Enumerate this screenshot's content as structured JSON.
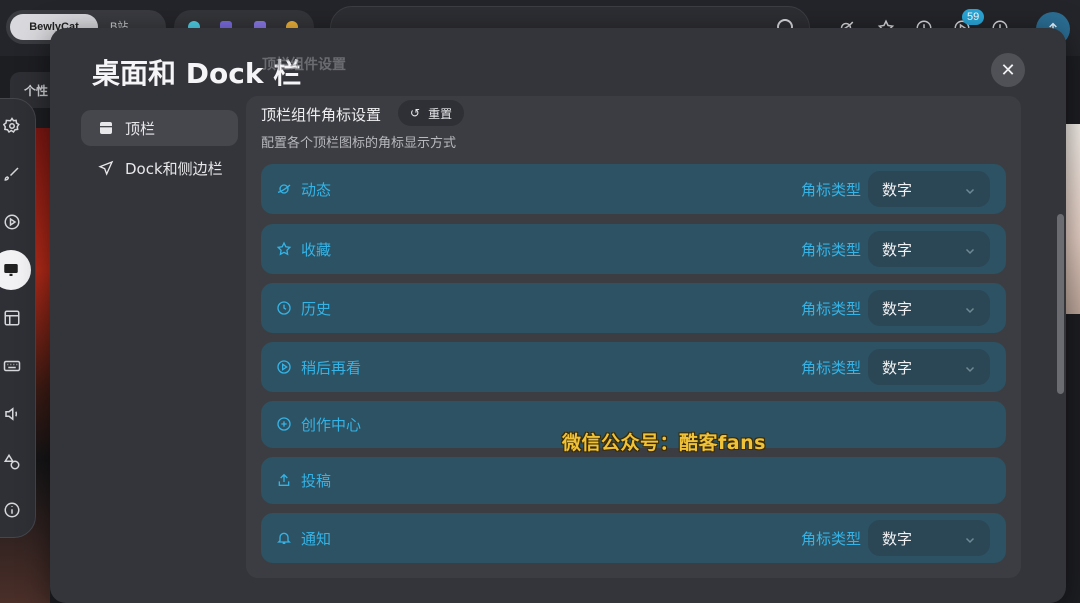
{
  "browser": {
    "active_tab": "BewlyCat",
    "inactive_tab": "B站",
    "notification_count": "59"
  },
  "background": {
    "chip_label": "个性"
  },
  "dock": {
    "items": [
      {
        "icon": "settings-icon"
      },
      {
        "icon": "brush-icon"
      },
      {
        "icon": "play-icon"
      },
      {
        "icon": "desktop-icon",
        "active": true
      },
      {
        "icon": "layout-icon"
      },
      {
        "icon": "keyboard-icon"
      },
      {
        "icon": "volume-icon"
      },
      {
        "icon": "shapes-icon"
      },
      {
        "icon": "info-icon"
      }
    ]
  },
  "modal": {
    "title": "桌面和 Dock 栏",
    "ghost_title": "顶栏组件设置",
    "nav": [
      {
        "label": "顶栏",
        "icon": "topbar-icon",
        "active": true
      },
      {
        "label": "Dock和侧边栏",
        "icon": "send-icon",
        "active": false
      }
    ],
    "section": {
      "title": "顶栏组件角标设置",
      "reset_label": "重置",
      "description": "配置各个顶栏图标的角标显示方式"
    },
    "rows": [
      {
        "label": "动态",
        "icon": "planet-icon",
        "type_label": "角标类型",
        "value": "数字"
      },
      {
        "label": "收藏",
        "icon": "star-icon",
        "type_label": "角标类型",
        "value": "数字"
      },
      {
        "label": "历史",
        "icon": "clock-icon",
        "type_label": "角标类型",
        "value": "数字"
      },
      {
        "label": "稍后再看",
        "icon": "watch-later-icon",
        "type_label": "角标类型",
        "value": "数字"
      },
      {
        "label": "创作中心",
        "icon": "plus-circle-icon"
      },
      {
        "label": "投稿",
        "icon": "upload-icon"
      },
      {
        "label": "通知",
        "icon": "bell-icon",
        "type_label": "角标类型",
        "value": "数字"
      }
    ]
  },
  "watermark": "微信公众号：酷客fans",
  "colors": {
    "accent": "#35b3e6",
    "row_bg": "#2c5263",
    "modal_bg": "#34353a",
    "content_bg": "#3c3d42"
  }
}
